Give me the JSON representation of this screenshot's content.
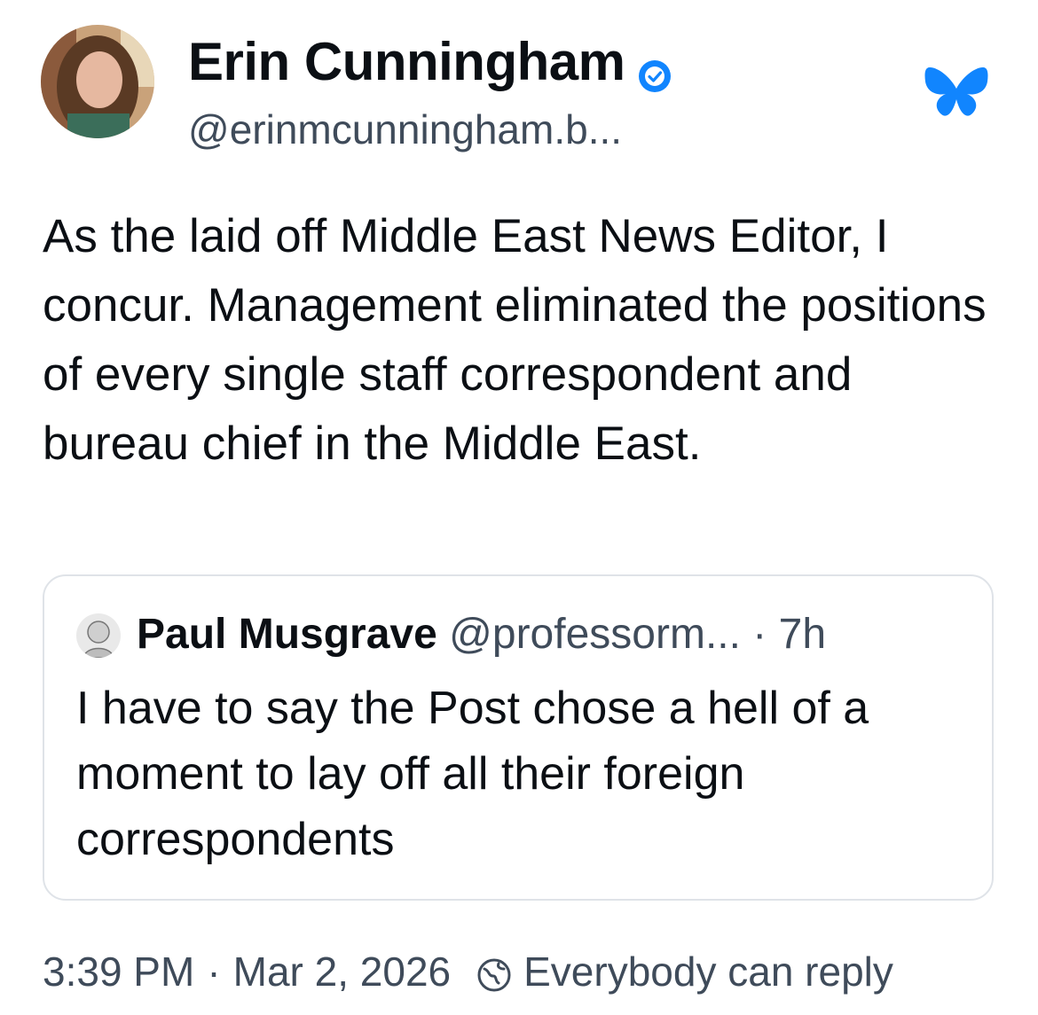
{
  "post": {
    "author": {
      "name": "Erin Cunningham",
      "handle": "@erinmcunningham.b...",
      "verified": true
    },
    "text": "As the laid off Middle East News Editor, I concur. Management eliminated the positions of every single staff correspondent and bureau chief in the Middle East.",
    "quote": {
      "author_name": "Paul Musgrave",
      "author_handle": "@professorm...",
      "separator": "·",
      "age": "7h",
      "text": "I have to say the Post chose a hell of a moment to lay off all their foreign correspondents"
    },
    "footer": {
      "time": "3:39 PM",
      "separator": "·",
      "date": "Mar 2, 2026",
      "reply_setting": "Everybody can reply"
    }
  },
  "icons": {
    "verified": "verified-badge-icon",
    "logo": "bluesky-butterfly-icon",
    "reply": "globe-icon"
  },
  "colors": {
    "brand_blue": "#1185fe",
    "text": "#0b0f14",
    "muted": "#3f4b5a",
    "border": "#dfe3e8"
  }
}
